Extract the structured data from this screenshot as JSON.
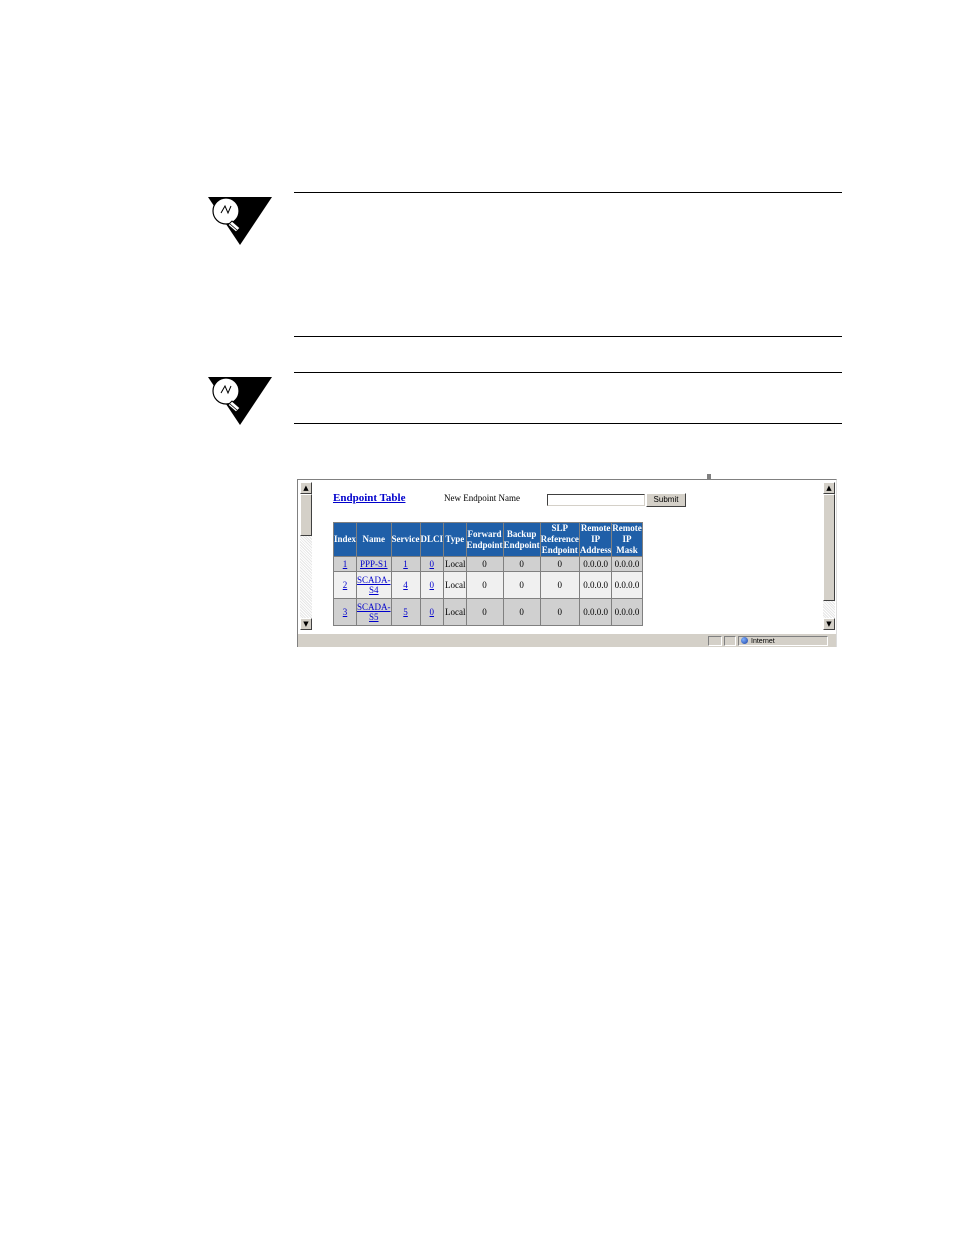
{
  "browser": {
    "status_zone": "Internet"
  },
  "endpoint_form": {
    "title": "Endpoint Table",
    "new_name_label": "New Endpoint Name",
    "new_name_value": "",
    "submit_label": "Submit"
  },
  "table": {
    "headers": {
      "index": "Index",
      "name": "Name",
      "service": "Service",
      "dlci": "DLCI",
      "type": "Type",
      "forward_1": "Forward",
      "forward_2": "Endpoint",
      "backup_1": "Backup",
      "backup_2": "Endpoint",
      "slp_1": "SLP Reference",
      "slp_2": "Endpoint",
      "rip_1": "Remote IP",
      "rip_2": "Address",
      "rmask_1": "Remote IP",
      "rmask_2": "Mask"
    },
    "rows": [
      {
        "index": "1",
        "name_1": "PPP-S1",
        "name_2": "",
        "service": "1",
        "dlci": "0",
        "type": "Local",
        "forward": "0",
        "backup": "0",
        "slp": "0",
        "remote_ip": "0.0.0.0",
        "remote_mask": "0.0.0.0"
      },
      {
        "index": "2",
        "name_1": "SCADA-",
        "name_2": "S4",
        "service": "4",
        "dlci": "0",
        "type": "Local",
        "forward": "0",
        "backup": "0",
        "slp": "0",
        "remote_ip": "0.0.0.0",
        "remote_mask": "0.0.0.0"
      },
      {
        "index": "3",
        "name_1": "SCADA-",
        "name_2": "S5",
        "service": "5",
        "dlci": "0",
        "type": "Local",
        "forward": "0",
        "backup": "0",
        "slp": "0",
        "remote_ip": "0.0.0.0",
        "remote_mask": "0.0.0.0"
      }
    ]
  },
  "colors": {
    "header_bg": "#1f5fa8",
    "link": "#0000cc",
    "row_dark": "#d0d0d0",
    "row_light": "#f0f0f0"
  }
}
